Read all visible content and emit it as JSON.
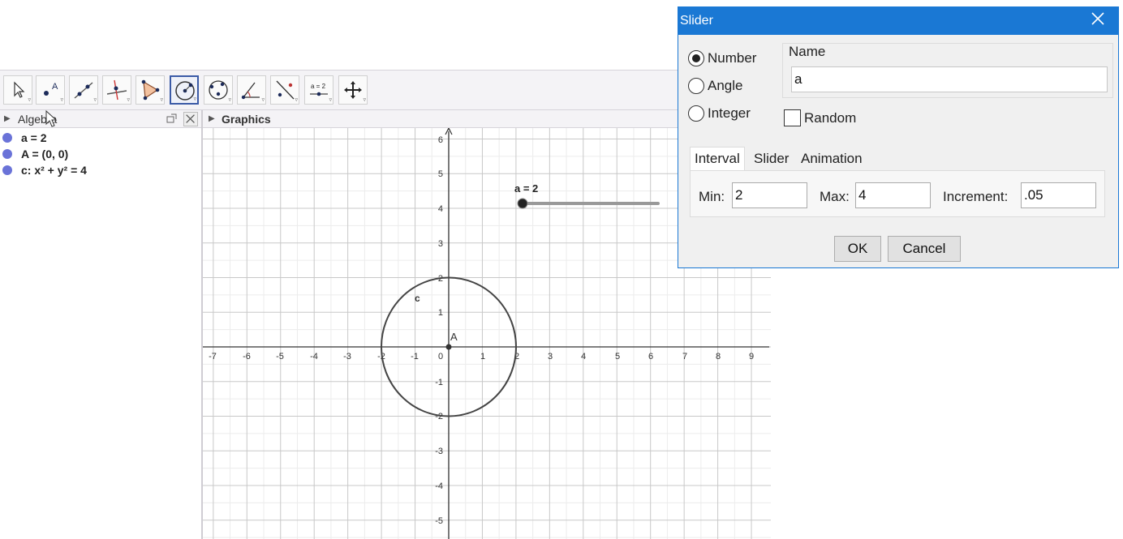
{
  "toolbar": {
    "tools": [
      {
        "icon": "move-arrow-icon"
      },
      {
        "icon": "point-icon",
        "label": "A"
      },
      {
        "icon": "line-icon"
      },
      {
        "icon": "perpendicular-line-icon"
      },
      {
        "icon": "polygon-icon"
      },
      {
        "icon": "circle-center-point-icon",
        "active": true
      },
      {
        "icon": "circle-three-points-icon"
      },
      {
        "icon": "angle-icon"
      },
      {
        "icon": "reflect-icon"
      },
      {
        "icon": "slider-icon",
        "label": "a = 2"
      },
      {
        "icon": "move-graphics-icon"
      }
    ]
  },
  "algebra": {
    "title": "Algebra",
    "items": [
      "a = 2",
      "A = (0, 0)",
      "c: x² + y² = 4"
    ],
    "dot_color": "#6a73d8"
  },
  "graphics": {
    "title": "Graphics",
    "x_ticks": [
      "-7",
      "-6",
      "-5",
      "-4",
      "-3",
      "-2",
      "-1",
      "0",
      "1",
      "2",
      "3",
      "4",
      "5",
      "6",
      "7",
      "8",
      "9"
    ],
    "y_ticks": [
      "6",
      "5",
      "4",
      "3",
      "2",
      "1",
      "-1",
      "-2",
      "-3",
      "-4",
      "-5"
    ],
    "slider_label": "a = 2",
    "circle_label": "c",
    "point_label": "A"
  },
  "dialog": {
    "title": "Slider",
    "types": [
      "Number",
      "Angle",
      "Integer"
    ],
    "selected_type": "Number",
    "name_label": "Name",
    "name_value": "a",
    "random_label": "Random",
    "tabs": [
      "Interval",
      "Slider",
      "Animation"
    ],
    "min_label": "Min:",
    "min_value": "2",
    "max_label": "Max:",
    "max_value": "4",
    "increment_label": "Increment:",
    "increment_value": ".05",
    "ok_label": "OK",
    "cancel_label": "Cancel",
    "accent_color": "#1a78d4"
  }
}
